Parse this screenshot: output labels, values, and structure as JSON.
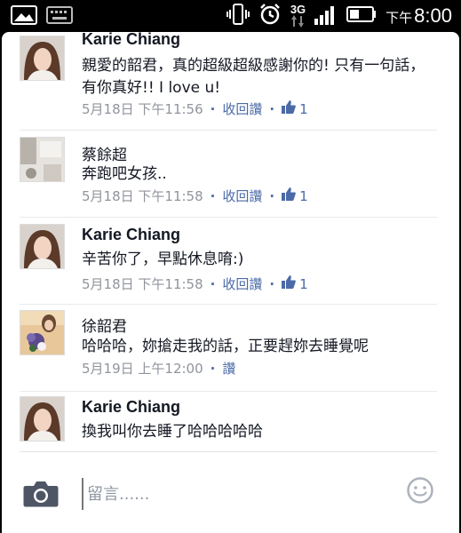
{
  "status_bar": {
    "time_prefix": "下午",
    "time": "8:00",
    "network": "3G"
  },
  "comments": [
    {
      "author": "Karie Chiang",
      "text": "親愛的韶君，真的超級超級感謝你的! 只有一句話，有你真好!! I love u!",
      "timestamp": "5月18日 下午11:56",
      "action": "收回讚",
      "like_count": "1",
      "avatar": "woman-portrait"
    },
    {
      "author": "蔡餘超",
      "text": "奔跑吧女孩..",
      "timestamp": "5月18日 下午11:58",
      "action": "收回讚",
      "like_count": "1",
      "avatar": "room-photo"
    },
    {
      "author": "Karie Chiang",
      "text": "辛苦你了，早點休息唷:)",
      "timestamp": "5月18日 下午11:58",
      "action": "收回讚",
      "like_count": "1",
      "avatar": "woman-portrait"
    },
    {
      "author": "徐韶君",
      "text": "哈哈哈，妳搶走我的話，正要趕妳去睡覺呢",
      "timestamp": "5月19日 上午12:00",
      "action": "讚",
      "like_count": "",
      "avatar": "flowers-photo"
    },
    {
      "author": "Karie Chiang",
      "text": "換我叫你去睡了哈哈哈哈哈",
      "timestamp": "",
      "action": "",
      "like_count": "",
      "avatar": "woman-portrait"
    }
  ],
  "composer": {
    "placeholder": "留言......"
  },
  "colors": {
    "link": "#4b6aa7",
    "meta": "#90949c",
    "text": "#141823"
  }
}
